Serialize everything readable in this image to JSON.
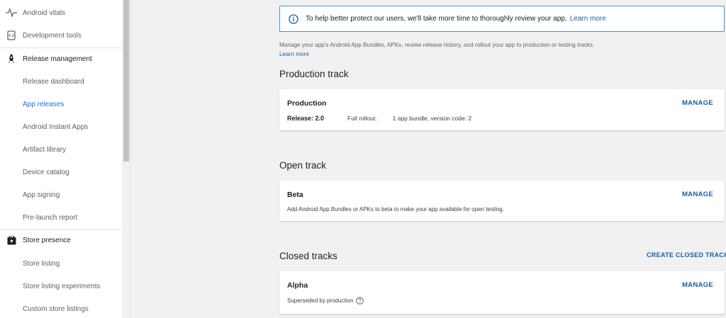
{
  "sidebar": {
    "items": [
      {
        "label": "Android vitals",
        "icon": "vitals-icon"
      },
      {
        "label": "Development tools",
        "icon": "dev-tools-icon"
      },
      {
        "label": "Release management",
        "icon": "rocket-icon"
      },
      {
        "label": "Release dashboard"
      },
      {
        "label": "App releases"
      },
      {
        "label": "Android Instant Apps"
      },
      {
        "label": "Artifact library"
      },
      {
        "label": "Device catalog"
      },
      {
        "label": "App signing"
      },
      {
        "label": "Pre-launch report"
      },
      {
        "label": "Store presence",
        "icon": "store-presence-icon"
      },
      {
        "label": "Store listing"
      },
      {
        "label": "Store listing experiments"
      },
      {
        "label": "Custom store listings"
      }
    ]
  },
  "banner": {
    "text": "To help better protect our users, we'll take more time to thoroughly review your app.",
    "link": "Learn more"
  },
  "description": {
    "text": "Manage your app's Android App Bundles, APKs, review release history, and rollout your app to production or testing tracks.",
    "link": "Learn more"
  },
  "production": {
    "title": "Production track",
    "card_name": "Production",
    "manage": "MANAGE",
    "release": "Release: 2.0",
    "rollout": "Full rollout.",
    "bundle": "1 app bundle, version code: 2"
  },
  "open": {
    "title": "Open track",
    "card_name": "Beta",
    "manage": "MANAGE",
    "text": "Add Android App Bundles or APKs to beta to make your app available for open testing."
  },
  "closed": {
    "title": "Closed tracks",
    "create": "CREATE CLOSED TRACK",
    "card_name": "Alpha",
    "manage": "MANAGE",
    "text": "Superseded by production"
  },
  "colors": {
    "accent": "#1a73e8",
    "link": "#1a5ea3",
    "banner_border": "#4a90d9",
    "background": "#f1f1f1"
  }
}
